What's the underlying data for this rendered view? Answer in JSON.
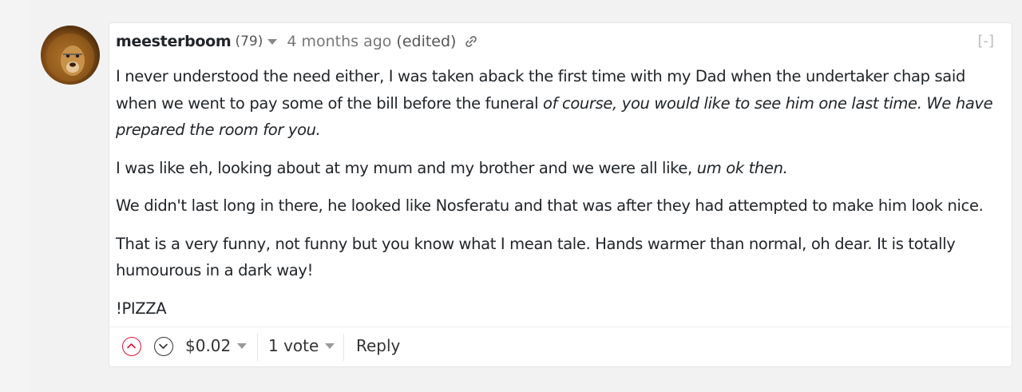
{
  "comment": {
    "author": "meesterboom",
    "reputation": "(79)",
    "timestamp": "4 months ago",
    "edited_label": "(edited)",
    "collapse_label": "[-]",
    "avatar_icon": "lion-avatar",
    "link_icon": "link-icon",
    "paragraphs": [
      {
        "plain": "I never understood the need either, I was taken aback the first time with my Dad when the undertaker chap said when we went to pay some of the bill before the funeral ",
        "italic": "of course, you would like to see him one last time. We have prepared the room for you."
      },
      {
        "plain": "I was like eh, looking about at my mum and my brother and we were all like, ",
        "italic": "um ok then."
      },
      {
        "plain": "We didn't last long in there, he looked like Nosferatu and that was after they had attempted to make him look nice.",
        "italic": ""
      },
      {
        "plain": "That is a very funny, not funny but you know what I mean tale. Hands warmer than normal, oh dear. It is totally humourous in a dark way!",
        "italic": ""
      },
      {
        "plain": "!PIZZA",
        "italic": ""
      }
    ],
    "footer": {
      "payout": "$0.02",
      "votes": "1 vote",
      "reply_label": "Reply"
    }
  },
  "colors": {
    "upvote": "#e31337",
    "text": "#212529",
    "muted": "#777777"
  }
}
